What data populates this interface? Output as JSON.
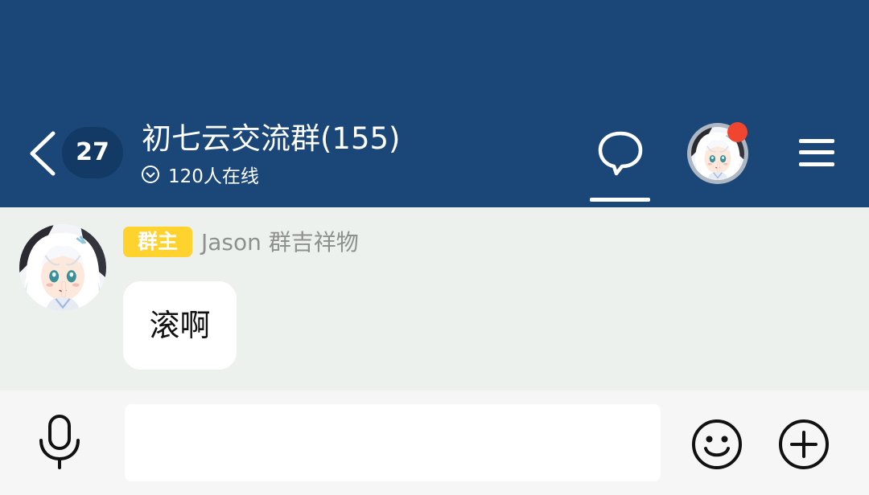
{
  "header": {
    "unread_count": "27",
    "group_title": "初七云交流群(155)",
    "online_status": "120人在线",
    "icons": {
      "back": "back-chevron-icon",
      "online": "chevron-circle-down-icon",
      "chat": "chat-bubble-icon",
      "menu": "hamburger-menu-icon"
    }
  },
  "messages": [
    {
      "role_badge": "群主",
      "sender": "Jason 群吉祥物",
      "text": "滚啊"
    }
  ],
  "input_bar": {
    "value": "",
    "icons": {
      "voice": "microphone-icon",
      "emoji": "smiley-face-icon",
      "more": "plus-circle-icon"
    }
  },
  "colors": {
    "header_bg": "#1a4678",
    "badge_bg": "#123a64",
    "chat_bg": "#edf1ee",
    "input_bar_bg": "#f6f6f6",
    "role_badge": "#ffd22e",
    "notification_dot": "#f0462f",
    "sender_name": "#8e9090"
  }
}
